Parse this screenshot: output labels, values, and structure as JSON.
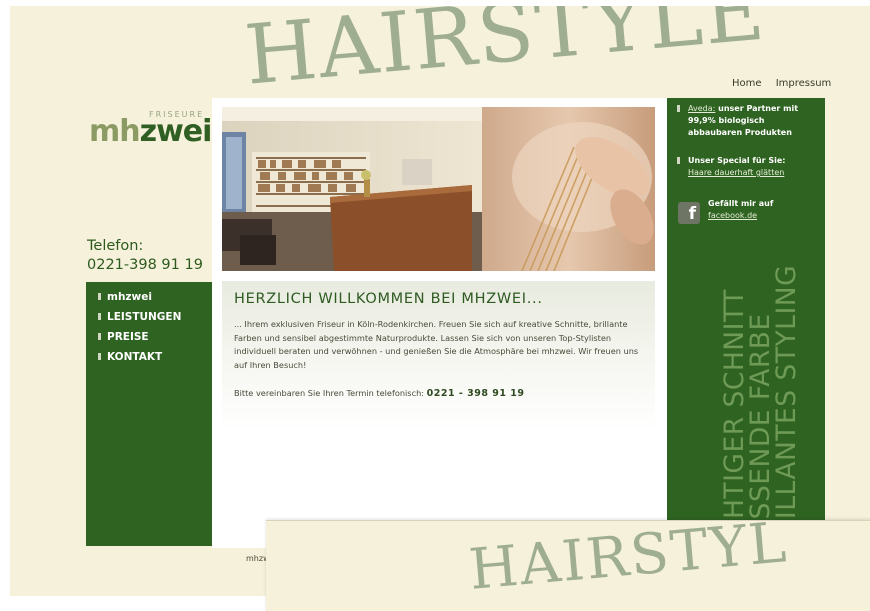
{
  "banner": {
    "headline": "HAIRSTYLE"
  },
  "topnav": {
    "home": "Home",
    "impressum": "Impressum"
  },
  "logo": {
    "tagline": "FRISEURE",
    "mh": "mh",
    "zwei": "zwei"
  },
  "contact": {
    "label": "Telefon:",
    "number": "0221-398 91 19"
  },
  "nav": {
    "items": [
      {
        "label": "mhzwei"
      },
      {
        "label": "LEISTUNGEN"
      },
      {
        "label": "PREISE"
      },
      {
        "label": "KONTAKT"
      }
    ]
  },
  "welcome": {
    "heading": "HERZLICH WILLKOMMEN BEI MHZWEI...",
    "body": "... Ihrem exklusiven Friseur in Köln-Rodenkirchen. Freuen Sie sich auf kreative Schnitte, brillante Farben und sensibel abgestimmte Naturprodukte. Lassen Sie sich von unseren Top-Stylisten individuell beraten und verwöhnen - und genießen Sie die Atmosphäre bei mhzwei. Wir freuen uns auf Ihren Besuch!",
    "call_text": "Bitte vereinbaren Sie Ihren Termin telefonisch:",
    "call_number": "0221 - 398 91 19"
  },
  "sidebar": {
    "aveda_link": "Aveda:",
    "aveda_text": "unser Partner mit 99,9% biologisch abbaubaren Produkten",
    "special_label": "Unser Special für Sie:",
    "special_link": "Haare dauerhaft glätten",
    "facebook_label": "Gefällt mir auf",
    "facebook_link": "facebook.de",
    "facebook_icon": "facebook-icon",
    "vertical_lines": [
      "CHTIGER SCHNITT",
      "ASSENDE FARBE",
      "RILLANTES STYLING"
    ]
  },
  "footer": {
    "text": "mhzwe"
  },
  "overlay": {
    "headline": "HAIRSTYL"
  },
  "colors": {
    "green": "#2f6322",
    "cream": "#f5f1da",
    "sage": "#9fae90"
  }
}
